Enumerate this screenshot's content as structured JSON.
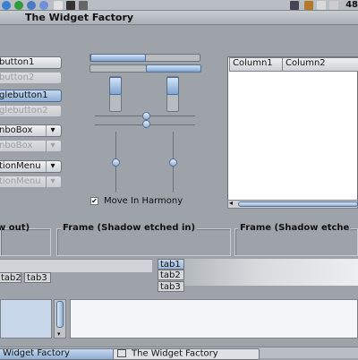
{
  "window": {
    "title": "The Widget Factory"
  },
  "tray": {
    "number": "48"
  },
  "buttons": {
    "button1": "button1",
    "button2": "button2",
    "togglebutton1": "glebutton1",
    "togglebutton2": "glebutton2",
    "combo1": "nboBox",
    "combo2": "nboBox",
    "optionmenu1": "tionMenu",
    "optionmenu2": "tionMenu"
  },
  "sliders": {
    "move_in_harmony_label": "Move In Harmony",
    "move_in_harmony_checked": true
  },
  "tree": {
    "columns": [
      "Column1",
      "Column2"
    ]
  },
  "frames": {
    "left": "w out)",
    "middle": "Frame (Shadow etched in)",
    "right": "Frame (Shadow etche"
  },
  "tabs_bottom": [
    "tab2",
    "tab3"
  ],
  "tabs_side": [
    "tab1",
    "tab2",
    "tab3"
  ],
  "taskbar": {
    "items": [
      "Widget Factory",
      "The Widget Factory"
    ]
  },
  "colors": {
    "accent": "#7fa3cf",
    "background": "#9da3a9"
  }
}
